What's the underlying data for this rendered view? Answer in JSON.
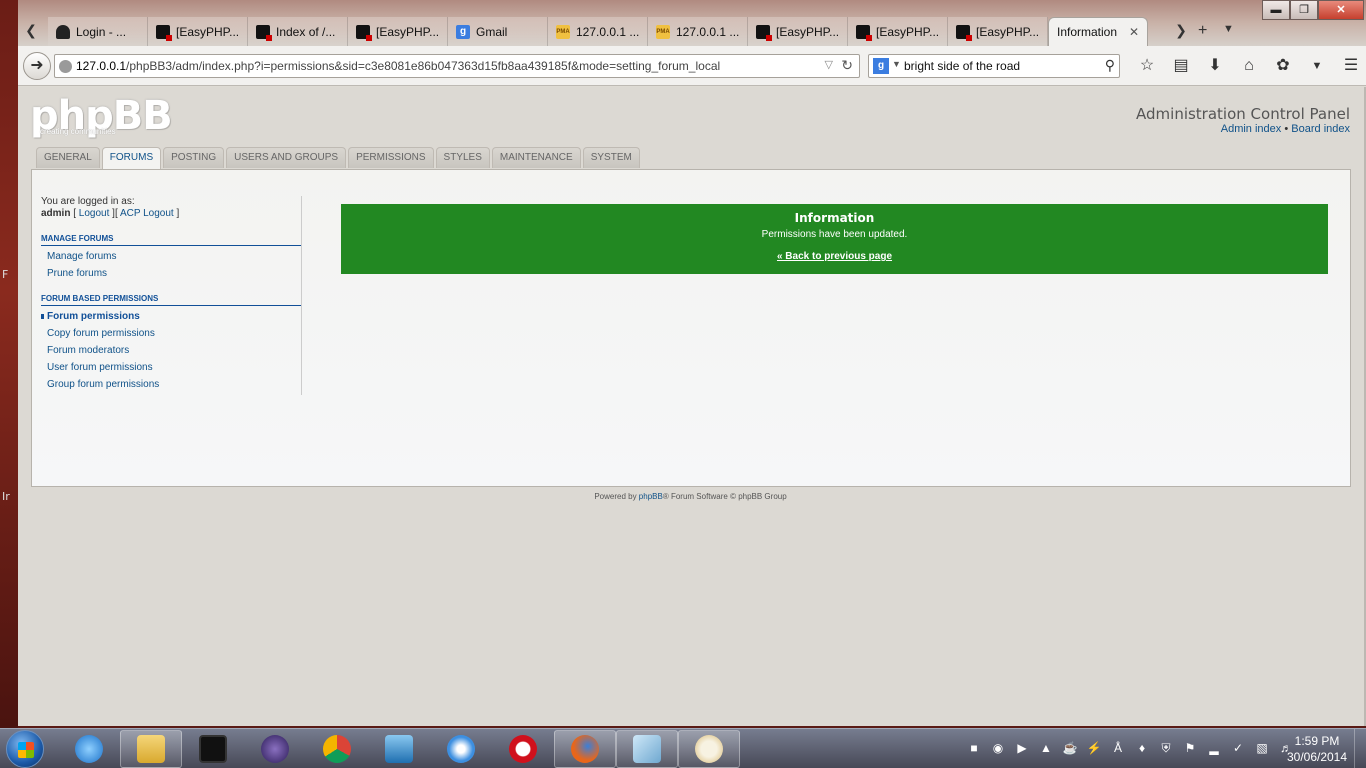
{
  "browser": {
    "tabs": [
      {
        "label": "Login - ...",
        "icon": "doc-icon"
      },
      {
        "label": "[EasyPHP...",
        "icon": "easyphp-icon"
      },
      {
        "label": "Index of /...",
        "icon": "easyphp-icon"
      },
      {
        "label": "[EasyPHP...",
        "icon": "easyphp-icon"
      },
      {
        "label": "Gmail",
        "icon": "google-icon"
      },
      {
        "label": "127.0.0.1 ...",
        "icon": "phpmyadmin-icon"
      },
      {
        "label": "127.0.0.1 ...",
        "icon": "phpmyadmin-icon"
      },
      {
        "label": "[EasyPHP...",
        "icon": "easyphp-icon"
      },
      {
        "label": "[EasyPHP...",
        "icon": "easyphp-icon"
      },
      {
        "label": "[EasyPHP...",
        "icon": "easyphp-icon"
      },
      {
        "label": "Information",
        "icon": "none",
        "active": true
      }
    ],
    "url_host": "127.0.0.1",
    "url_path": "/phpBB3/adm/index.php?i=permissions&sid=c3e8081e86b047363d15fb8aa439185f&mode=setting_forum_local",
    "search_value": "bright side of the road",
    "search_engine_glyph": "g"
  },
  "acp": {
    "logo_text": "phpBB",
    "logo_sub": "creating communities",
    "title": "Administration Control Panel",
    "links": {
      "admin_index": "Admin index",
      "board_index": "Board index",
      "separator": "•"
    },
    "tabs": [
      "GENERAL",
      "FORUMS",
      "POSTING",
      "USERS AND GROUPS",
      "PERMISSIONS",
      "STYLES",
      "MAINTENANCE",
      "SYSTEM"
    ],
    "active_tab": "FORUMS",
    "logged_in_label": "You are logged in as:",
    "username": "admin",
    "logout": "Logout",
    "acp_logout": "ACP Logout",
    "menu": {
      "manage_forums_head": "MANAGE FORUMS",
      "manage_forums_items": [
        "Manage forums",
        "Prune forums"
      ],
      "permissions_head": "FORUM BASED PERMISSIONS",
      "permissions_items": [
        "Forum permissions",
        "Copy forum permissions",
        "Forum moderators",
        "User forum permissions",
        "Group forum permissions"
      ]
    },
    "info": {
      "title": "Information",
      "message": "Permissions have been updated.",
      "back_link": "« Back to previous page",
      "color": "#228822"
    },
    "footer": {
      "prefix": "Powered by ",
      "brand": "phpBB",
      "suffix": "® Forum Software © phpBB Group"
    }
  },
  "taskbar": {
    "time": "1:59 PM",
    "date": "30/06/2014"
  }
}
